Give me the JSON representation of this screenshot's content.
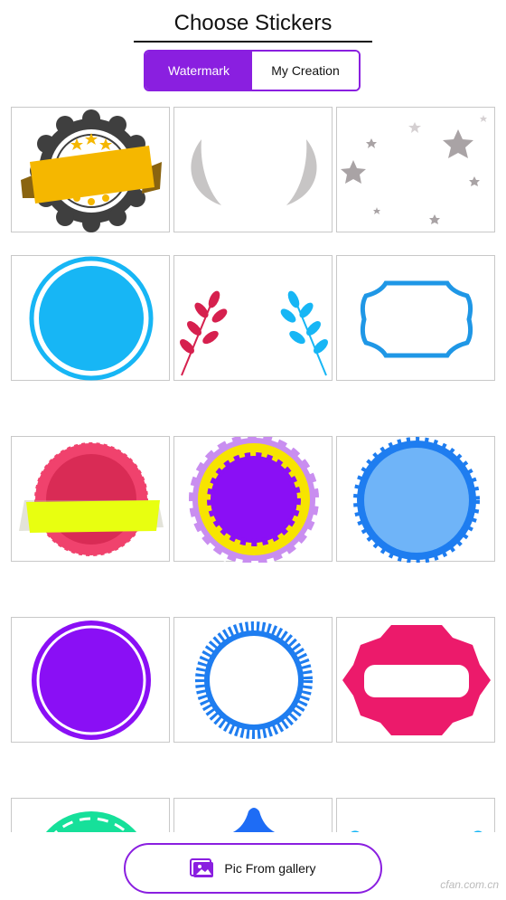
{
  "header": {
    "title": "Choose Stickers"
  },
  "tabs": [
    {
      "label": "Watermark",
      "active": true
    },
    {
      "label": "My Creation",
      "active": false
    }
  ],
  "stickers": [
    {
      "name": "sticker-badge-gold-ribbon"
    },
    {
      "name": "sticker-tusks"
    },
    {
      "name": "sticker-stars"
    },
    {
      "name": "sticker-blue-circle"
    },
    {
      "name": "sticker-leaf-branches"
    },
    {
      "name": "sticker-blue-frame"
    },
    {
      "name": "sticker-red-seal-ribbon"
    },
    {
      "name": "sticker-flower-badge"
    },
    {
      "name": "sticker-blue-sunburst"
    },
    {
      "name": "sticker-purple-circle"
    },
    {
      "name": "sticker-blue-ring"
    },
    {
      "name": "sticker-pink-label"
    },
    {
      "name": "sticker-green-dome"
    },
    {
      "name": "sticker-blue-peak"
    },
    {
      "name": "sticker-partial"
    }
  ],
  "footer": {
    "gallery_label": "Pic From gallery",
    "watermark_text": "cfan.com.cn"
  },
  "colors": {
    "accent": "#8a1fe0",
    "sticker_blue": "#17b6f5",
    "sticker_purple": "#8a0ff5",
    "sticker_pink": "#ec1a6b"
  }
}
